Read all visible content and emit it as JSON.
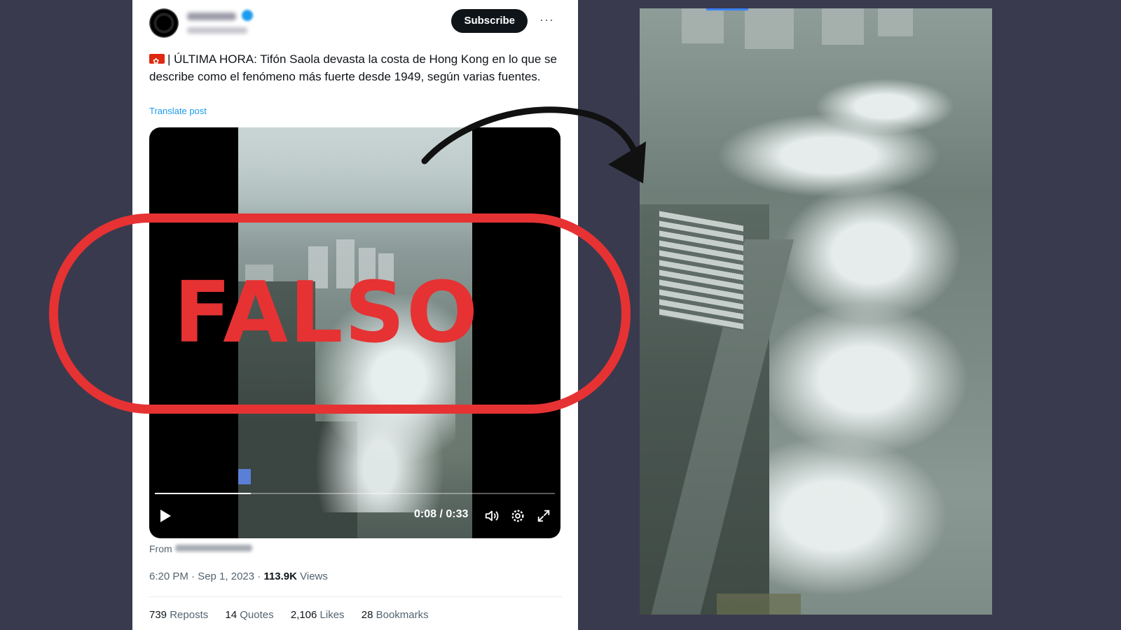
{
  "tweet": {
    "subscribe_label": "Subscribe",
    "more_label": "···",
    "text": "| ÚLTIMA HORA: Tifón Saola devasta la costa de Hong Kong en lo que se describe como el fenómeno más fuerte desde 1949, según varias fuentes.",
    "translate_label": "Translate post",
    "from_label": "From",
    "time": "6:20 PM · Sep 1, 2023 · ",
    "views_count": "113.9K",
    "views_label": " Views"
  },
  "video": {
    "time_display": "0:08 / 0:33",
    "progress_fraction": 0.24
  },
  "stats": [
    {
      "count": "739",
      "label": "Reposts"
    },
    {
      "count": "14",
      "label": "Quotes"
    },
    {
      "count": "2,106",
      "label": "Likes"
    },
    {
      "count": "28",
      "label": "Bookmarks"
    }
  ],
  "stamp": {
    "label": "FALSO",
    "color": "#e63233"
  },
  "icons": {
    "play": "play-icon",
    "volume": "volume-icon",
    "settings": "gear-icon",
    "fullscreen": "fullscreen-icon",
    "flag": "hong-kong-flag-icon"
  }
}
